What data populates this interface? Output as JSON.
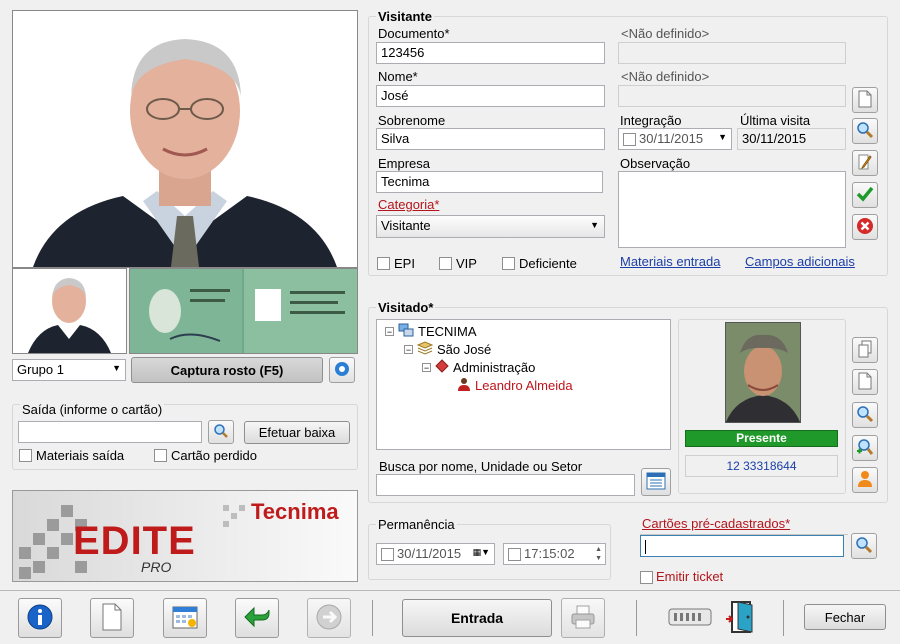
{
  "photo": {
    "grupo_select": "Grupo 1",
    "capture_button": "Captura rosto (F5)"
  },
  "saida": {
    "title": "Saída (informe o cartão)",
    "input_value": "",
    "efetuar_baixa": "Efetuar baixa",
    "materiais_saida": "Materiais saída",
    "cartao_perdido": "Cartão perdido"
  },
  "logo": {
    "product": "EDITE",
    "product_sub": "PRO",
    "company": "Tecnima"
  },
  "visitante": {
    "title": "Visitante",
    "documento_label": "Documento*",
    "documento_value": "123456",
    "documento_type": "<Não definido>",
    "nome_label": "Nome*",
    "nome_value": "José",
    "nome_type": "<Não definido>",
    "sobrenome_label": "Sobrenome",
    "sobrenome_value": "Silva",
    "empresa_label": "Empresa",
    "empresa_value": "Tecnima",
    "categoria_label": "Categoria*",
    "categoria_value": "Visitante",
    "epi": "EPI",
    "vip": "VIP",
    "deficiente": "Deficiente",
    "integracao_label": "Integração",
    "integracao_value": "30/11/2015",
    "ultima_visita_label": "Última visita",
    "ultima_visita_value": "30/11/2015",
    "observacao_label": "Observação",
    "observacao_value": "",
    "materiais_entrada": "Materiais entrada",
    "campos_adicionais": "Campos adicionais"
  },
  "visitado": {
    "title": "Visitado*",
    "tree": [
      "TECNIMA",
      "São José",
      "Administração",
      "Leandro Almeida"
    ],
    "busca_label": "Busca por nome, Unidade ou Setor",
    "busca_value": "",
    "status": "Presente",
    "phone": "12 33318644"
  },
  "permanencia": {
    "title": "Permanência",
    "date": "30/11/2015",
    "time": "17:15:02"
  },
  "cartoes": {
    "label": "Cartões pré-cadastrados*",
    "value": "",
    "emitir_ticket": "Emitir ticket"
  },
  "toolbar": {
    "entrada": "Entrada",
    "fechar": "Fechar"
  },
  "colors": {
    "accent_green": "#1f9a2a",
    "link_blue": "#1b3fa6",
    "required_red": "#b3151c"
  }
}
